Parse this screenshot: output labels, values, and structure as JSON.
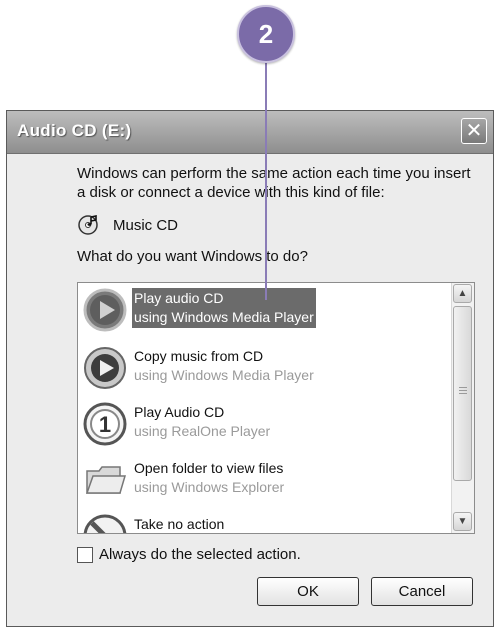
{
  "callout": {
    "number": "2"
  },
  "window": {
    "title": "Audio CD (E:)",
    "close_glyph": "✕"
  },
  "description": {
    "line1": "Windows can perform the same action each time you insert",
    "line2": "a disk or connect a device with this kind of file:"
  },
  "device": {
    "label": "Music CD",
    "icon": "music-cd-icon"
  },
  "question": "What do you want Windows to do?",
  "actions": [
    {
      "title": "Play audio CD",
      "subtitle": "using Windows Media Player",
      "icon": "play-icon",
      "selected": true
    },
    {
      "title": "Copy music from CD",
      "subtitle": "using Windows Media Player",
      "icon": "copy-cd-icon",
      "selected": false
    },
    {
      "title": "Play Audio CD",
      "subtitle": "using RealOne Player",
      "icon": "realone-icon",
      "selected": false
    },
    {
      "title": "Open folder to view files",
      "subtitle": "using Windows Explorer",
      "icon": "folder-icon",
      "selected": false
    },
    {
      "title": "Take no action",
      "subtitle": "",
      "icon": "no-action-icon",
      "selected": false
    }
  ],
  "always_checkbox": {
    "label": "Always do the selected action.",
    "checked": false
  },
  "buttons": {
    "ok": "OK",
    "cancel": "Cancel"
  },
  "colors": {
    "selection": "#6b6b6b",
    "callout": "#7b6ba8"
  }
}
